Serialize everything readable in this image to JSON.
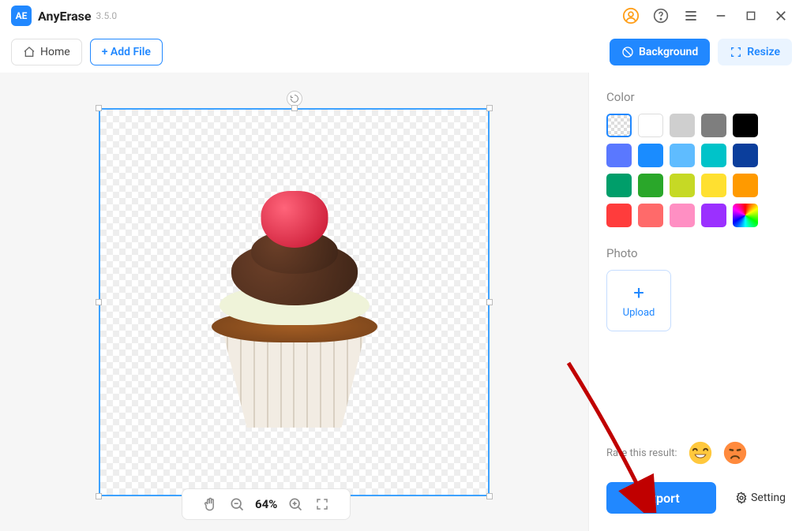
{
  "app": {
    "name": "AnyErase",
    "version": "3.5.0"
  },
  "toolbar": {
    "home": "Home",
    "add_file": "+ Add File",
    "background": "Background",
    "resize": "Resize"
  },
  "panel": {
    "color_label": "Color",
    "photo_label": "Photo",
    "upload": "Upload",
    "swatches": [
      {
        "name": "transparent",
        "value": "transparent",
        "selected": true
      },
      {
        "name": "white",
        "value": "#ffffff"
      },
      {
        "name": "light-grey",
        "value": "#cfcfcf"
      },
      {
        "name": "grey",
        "value": "#7e7e7e"
      },
      {
        "name": "black",
        "value": "#000000"
      },
      {
        "name": "blue",
        "value": "#5a78ff"
      },
      {
        "name": "azure",
        "value": "#1a8cff"
      },
      {
        "name": "sky",
        "value": "#5fbcff"
      },
      {
        "name": "teal",
        "value": "#00c3c9"
      },
      {
        "name": "navy",
        "value": "#0b3e9c"
      },
      {
        "name": "emerald",
        "value": "#009e6a"
      },
      {
        "name": "green",
        "value": "#2aa72a"
      },
      {
        "name": "lime",
        "value": "#c6d925"
      },
      {
        "name": "yellow",
        "value": "#ffe030"
      },
      {
        "name": "orange",
        "value": "#ff9a00"
      },
      {
        "name": "red",
        "value": "#ff3c3c"
      },
      {
        "name": "salmon",
        "value": "#ff6a6a"
      },
      {
        "name": "pink",
        "value": "#ff8fc3"
      },
      {
        "name": "purple",
        "value": "#9b30ff"
      },
      {
        "name": "rainbow",
        "value": "rainbow"
      }
    ]
  },
  "rate": {
    "label": "Rate this result:"
  },
  "export": {
    "label": "Export"
  },
  "setting": {
    "label": "Setting"
  },
  "zoom": {
    "value": "64%"
  }
}
